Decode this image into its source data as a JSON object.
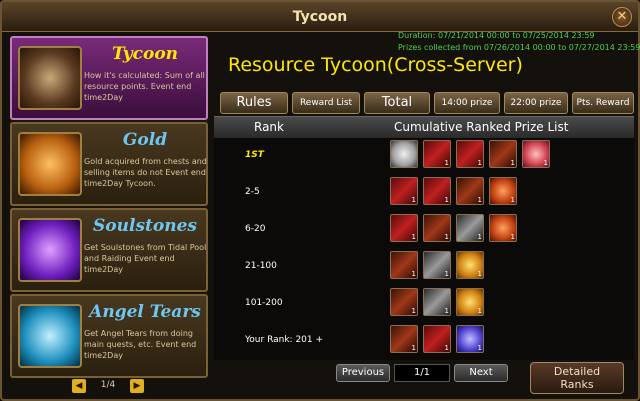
{
  "window": {
    "title": "Tycoon"
  },
  "sidebar": {
    "cards": [
      {
        "name": "Tycoon",
        "desc": "How it's calculated: Sum of all resource points. Event end time2Day",
        "color": "#ffe800"
      },
      {
        "name": "Gold",
        "desc": "Gold acquired from chests and selling items do not Event end time2Day Tycoon.",
        "color": "#6cc8f0"
      },
      {
        "name": "Soulstones",
        "desc": "Get Soulstones from Tidal Pool and Raiding Event end time2Day",
        "color": "#6cc8f0"
      },
      {
        "name": "Angel Tears",
        "desc": "Get Angel Tears from doing main quests, etc. Event end time2Day",
        "color": "#6cc8f0"
      }
    ],
    "page": "1/4"
  },
  "header": {
    "duration": "Duration: 07/21/2014 00:00 to 07/25/2014 23:59",
    "collected": "Prizes collected from 07/26/2014 00:00 to 07/27/2014 23:59",
    "title": "Resource Tycoon(Cross-Server)"
  },
  "tabs": [
    "Rules",
    "Reward List",
    "Total",
    "14:00 prize",
    "22:00 prize",
    "Pts. Reward"
  ],
  "table": {
    "col_rank": "Rank",
    "col_list": "Cumulative Ranked Prize List",
    "rows": [
      {
        "rank": "1ST",
        "items": [
          {
            "c": "i-angel",
            "q": ""
          },
          {
            "c": "i-red",
            "q": "1"
          },
          {
            "c": "i-red",
            "q": "1"
          },
          {
            "c": "i-red2",
            "q": "1"
          },
          {
            "c": "i-pink",
            "q": "1"
          }
        ]
      },
      {
        "rank": "2-5",
        "items": [
          {
            "c": "i-red",
            "q": "1"
          },
          {
            "c": "i-red",
            "q": "1"
          },
          {
            "c": "i-red2",
            "q": "1"
          },
          {
            "c": "i-orange",
            "q": "1"
          }
        ]
      },
      {
        "rank": "6-20",
        "items": [
          {
            "c": "i-red",
            "q": "1"
          },
          {
            "c": "i-red2",
            "q": "1"
          },
          {
            "c": "i-dark",
            "q": "1"
          },
          {
            "c": "i-orange",
            "q": "1"
          }
        ]
      },
      {
        "rank": "21-100",
        "items": [
          {
            "c": "i-red2",
            "q": "1"
          },
          {
            "c": "i-dark",
            "q": "1"
          },
          {
            "c": "i-gold",
            "q": "1"
          }
        ]
      },
      {
        "rank": "101-200",
        "items": [
          {
            "c": "i-red2",
            "q": "1"
          },
          {
            "c": "i-dark",
            "q": "1"
          },
          {
            "c": "i-gold",
            "q": "1"
          }
        ]
      },
      {
        "rank": "Your Rank: 201 +",
        "items": [
          {
            "c": "i-red2",
            "q": "1"
          },
          {
            "c": "i-red",
            "q": "1"
          },
          {
            "c": "i-blue",
            "q": "1"
          }
        ]
      }
    ]
  },
  "pagination": {
    "previous": "Previous",
    "page": "1/1",
    "next": "Next",
    "detailed_1": "Detailed",
    "detailed_2": "Ranks"
  }
}
